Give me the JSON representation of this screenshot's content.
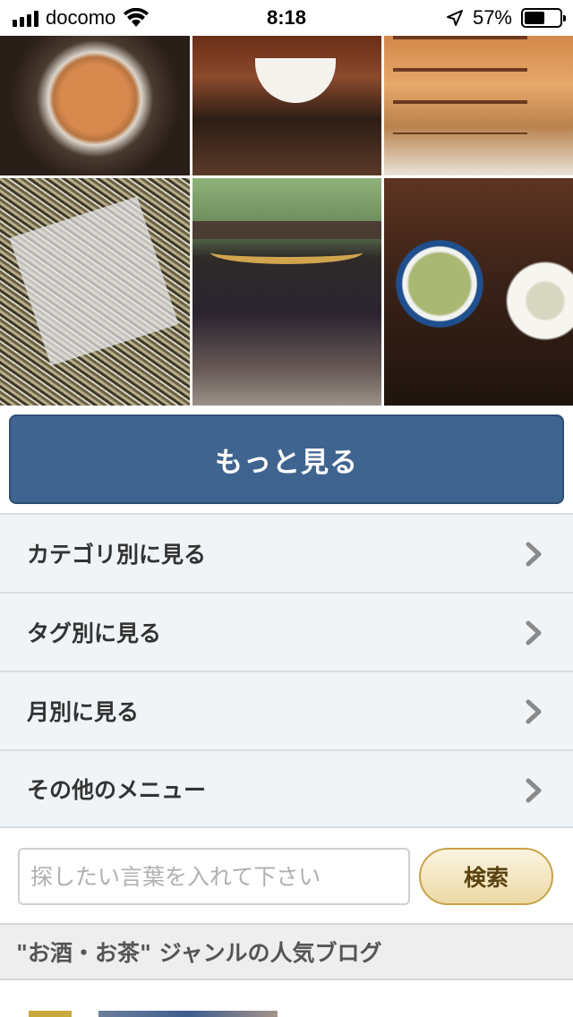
{
  "status_bar": {
    "carrier": "docomo",
    "time": "8:18",
    "battery_percent": "57%",
    "battery_level": 0.57,
    "icons": [
      "signal-icon",
      "wifi-icon",
      "location-arrow-icon",
      "battery-icon"
    ]
  },
  "photos": [
    {
      "name": "tea-cup-closeup-photo"
    },
    {
      "name": "teapot-white-cup-photo"
    },
    {
      "name": "tea-shop-interior-photo"
    },
    {
      "name": "tea-leaves-wrapper-photo"
    },
    {
      "name": "shrine-gate-photo"
    },
    {
      "name": "brewed-leaves-bowl-photo"
    }
  ],
  "more_button": {
    "label": "もっと見る"
  },
  "menu": {
    "items": [
      {
        "label": "カテゴリ別に見る"
      },
      {
        "label": "タグ別に見る"
      },
      {
        "label": "月別に見る"
      },
      {
        "label": "その他のメニュー"
      }
    ]
  },
  "search": {
    "placeholder": "探したい言葉を入れて下さい",
    "value": "",
    "button_label": "検索"
  },
  "popular_section": {
    "title": "\"お酒・お茶\" ジャンルの人気ブログ"
  },
  "colors": {
    "more_button_bg": "#3f648f",
    "menu_bg": "#f0f4f7",
    "search_button_border": "#c8a24a"
  }
}
